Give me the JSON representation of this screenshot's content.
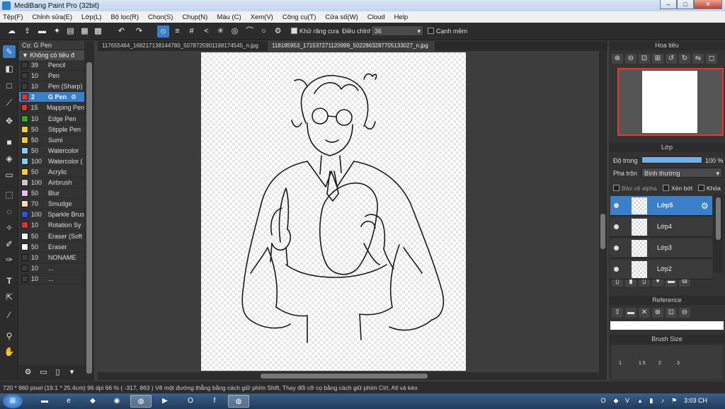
{
  "window": {
    "title": "MediBang Paint Pro (32bit)",
    "min": "–",
    "max": "□",
    "close": "✕"
  },
  "menu": [
    "Tệp(F)",
    "Chỉnh sửa(E)",
    "Lớp(L)",
    "Bộ lọc(R)",
    "Chọn(S)",
    "Chụp(N)",
    "Màu (C)",
    "Xem(V)",
    "Công cụ(T)",
    "Cửa số(W)",
    "Cloud",
    "Help"
  ],
  "toolbar": {
    "antialias_label": "Khử răng cưa",
    "correction_label": "Điều chỉnh",
    "correction_value": "36",
    "edge_label": "Cạnh mềm"
  },
  "brush_panel": {
    "title": "Cọ: G Pen",
    "folder": "Không có tiêu đ",
    "brushes": [
      {
        "size": "39",
        "name": "Pencil",
        "color": "#3a3a3a"
      },
      {
        "size": "10",
        "name": "Pen",
        "color": "#3a3a3a"
      },
      {
        "size": "10",
        "name": "Pen (Sharp)",
        "color": "#3a3a3a"
      },
      {
        "size": "2",
        "name": "G Pen",
        "color": "#e03030",
        "selected": true
      },
      {
        "size": "15",
        "name": "Mapping Pen",
        "color": "#e03030"
      },
      {
        "size": "10",
        "name": "Edge Pen",
        "color": "#2fa82f"
      },
      {
        "size": "50",
        "name": "Stipple Pen",
        "color": "#f0d020"
      },
      {
        "size": "50",
        "name": "Sumi",
        "color": "#f0d020"
      },
      {
        "size": "50",
        "name": "Watercolor",
        "color": "#80d0f0"
      },
      {
        "size": "100",
        "name": "Watercolor (",
        "color": "#80d0f0"
      },
      {
        "size": "50",
        "name": "Acrylic",
        "color": "#f0d020"
      },
      {
        "size": "100",
        "name": "Airbrush",
        "color": "#c8c8c8"
      },
      {
        "size": "50",
        "name": "Blur",
        "color": "#f0b8f0"
      },
      {
        "size": "70",
        "name": "Smudge",
        "color": "#f8d8b8"
      },
      {
        "size": "100",
        "name": "Sparkle Brus",
        "color": "#3050e0"
      },
      {
        "size": "10",
        "name": "Rotation Sy",
        "color": "#e03030"
      },
      {
        "size": "50",
        "name": "Eraser (Soft",
        "color": "#ffffff"
      },
      {
        "size": "50",
        "name": "Eraser",
        "color": "#ffffff"
      },
      {
        "size": "10",
        "name": "NONAME",
        "color": "#3a3a3a"
      },
      {
        "size": "10",
        "name": "...",
        "color": "#3a3a3a"
      },
      {
        "size": "10",
        "name": "...",
        "color": "#3a3a3a"
      }
    ]
  },
  "tabs": [
    "117655464_168217138144780_5078725901198174545_n.jpg",
    "118185953_171537271120999_5022863287705133027_n.jpg"
  ],
  "navigator": {
    "title": "Hoa tiêu"
  },
  "layers": {
    "title": "Lớp",
    "opacity_label": "Độ trong",
    "opacity_value": "100 %",
    "blend_label": "Pha trộn",
    "blend_value": "Bình thường",
    "protect_alpha": "Bảo vệ alpha",
    "clipping": "Xén bớt",
    "lock": "Khóa",
    "items": [
      {
        "name": "Lớp5",
        "selected": true
      },
      {
        "name": "Lớp4"
      },
      {
        "name": "Lớp3"
      },
      {
        "name": "Lớp2"
      }
    ]
  },
  "reference": {
    "title": "Reference"
  },
  "brush_size": {
    "title": "Brush Size",
    "sizes": [
      "1",
      "1.5",
      "2",
      "3"
    ]
  },
  "status": {
    "size": "720 * 960 pixel",
    "physical": "(19.1 * 25.4cm)",
    "dpi": "96 dpi",
    "zoom": "66 %",
    "coords": "( -317, 863 )",
    "hint": "Vẽ một đường thẳng bằng cách giữ phím Shift, Thay đổi cỡ cọ bằng cách giữ phím Ctrl, Alt và kéo"
  },
  "taskbar": {
    "clock": "3:03 CH"
  }
}
